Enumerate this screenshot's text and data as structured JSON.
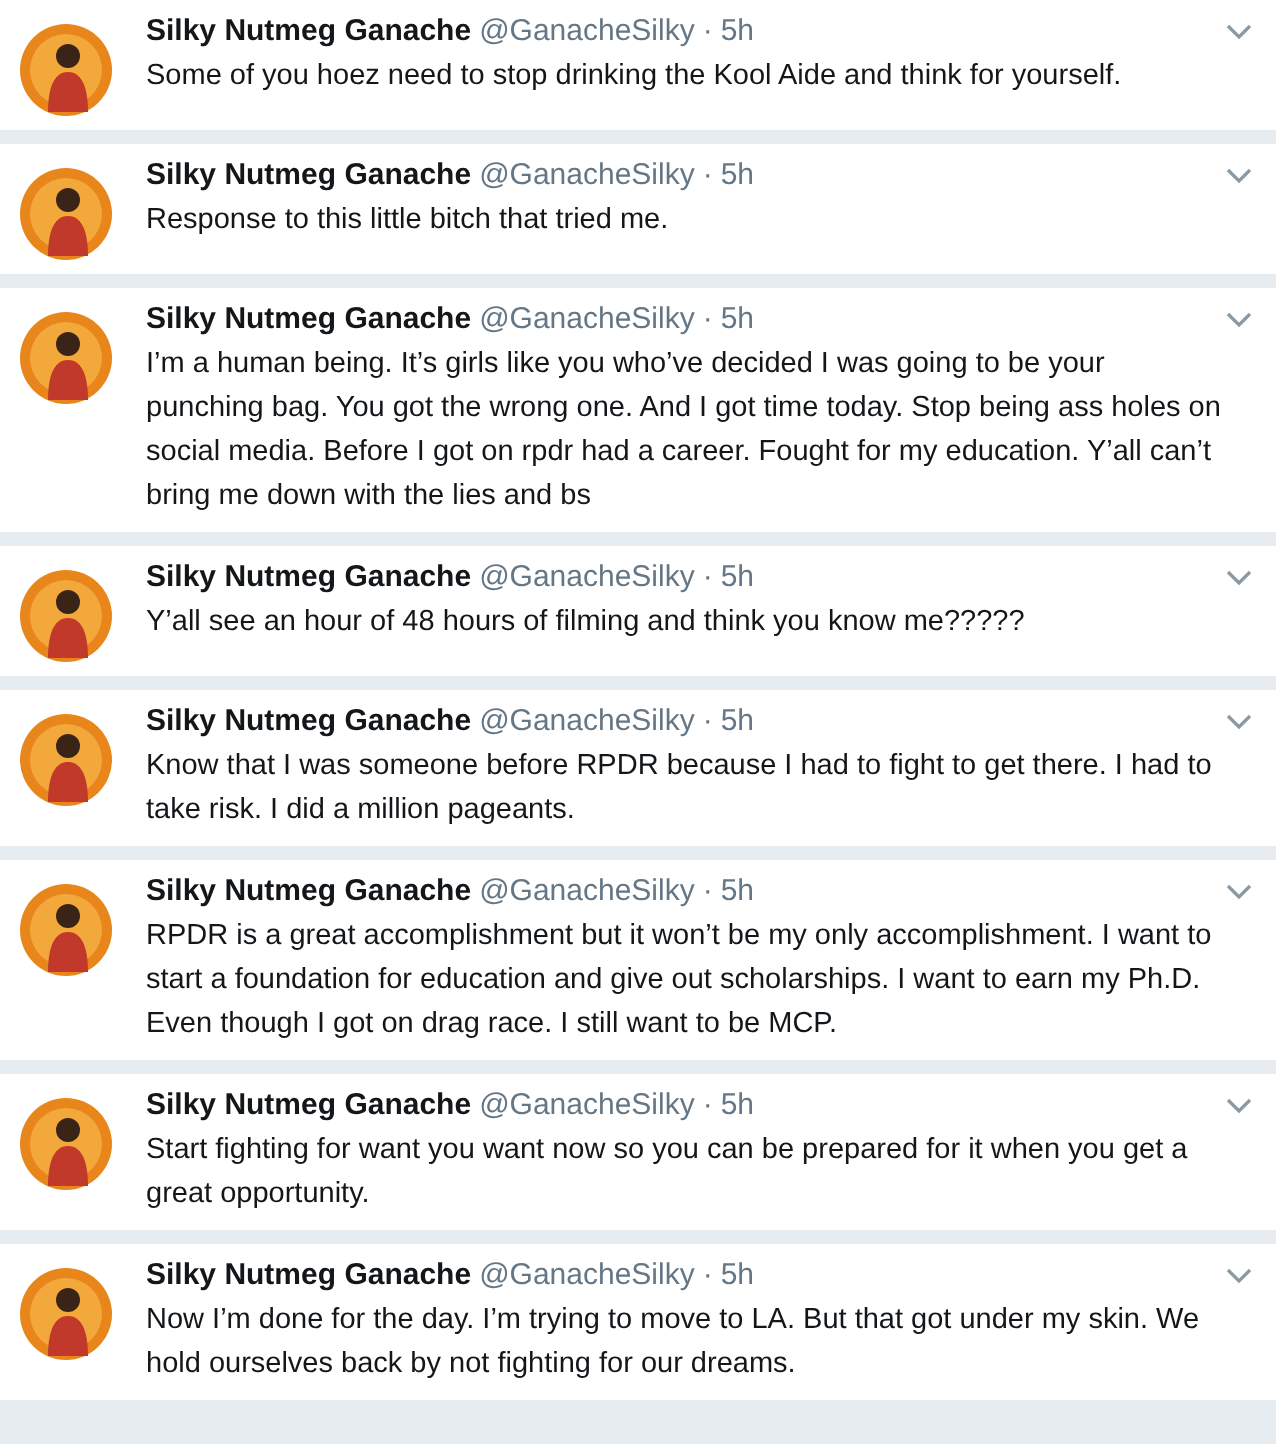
{
  "separator": "·",
  "tweets": [
    {
      "name": "Silky Nutmeg Ganache",
      "handle": "@GanacheSilky",
      "time": "5h",
      "text": "Some of you hoez need to stop drinking the Kool Aide and think for yourself."
    },
    {
      "name": "Silky Nutmeg Ganache",
      "handle": "@GanacheSilky",
      "time": "5h",
      "text": "Response to this little bitch that tried me."
    },
    {
      "name": "Silky Nutmeg Ganache",
      "handle": "@GanacheSilky",
      "time": "5h",
      "text": "I’m a human being. It’s girls like you who’ve decided I was going to be your punching bag. You got the wrong one. And I got time today. Stop being ass holes on social media. Before I got on rpdr had a career. Fought for my education. Y’all can’t bring me down with the lies and bs"
    },
    {
      "name": "Silky Nutmeg Ganache",
      "handle": "@GanacheSilky",
      "time": "5h",
      "text": "Y’all see an hour of 48 hours of filming and think you know me?????"
    },
    {
      "name": "Silky Nutmeg Ganache",
      "handle": "@GanacheSilky",
      "time": "5h",
      "text": "Know that I was someone before RPDR because I had to fight to get there. I had to take risk. I did a million pageants."
    },
    {
      "name": "Silky Nutmeg Ganache",
      "handle": "@GanacheSilky",
      "time": "5h",
      "text": "RPDR is a great accomplishment but it won’t be my only accomplishment. I want to start a foundation for education and give out scholarships. I want to earn my Ph.D. Even though I got on drag race. I still want to be MCP."
    },
    {
      "name": "Silky Nutmeg Ganache",
      "handle": "@GanacheSilky",
      "time": "5h",
      "text": "Start fighting for want you want now so you can be prepared for it when you get a great opportunity."
    },
    {
      "name": "Silky Nutmeg Ganache",
      "handle": "@GanacheSilky",
      "time": "5h",
      "text": "Now I’m done for the day. I’m trying to move to LA. But that got under my skin. We hold ourselves back by not fighting for our dreams."
    }
  ]
}
